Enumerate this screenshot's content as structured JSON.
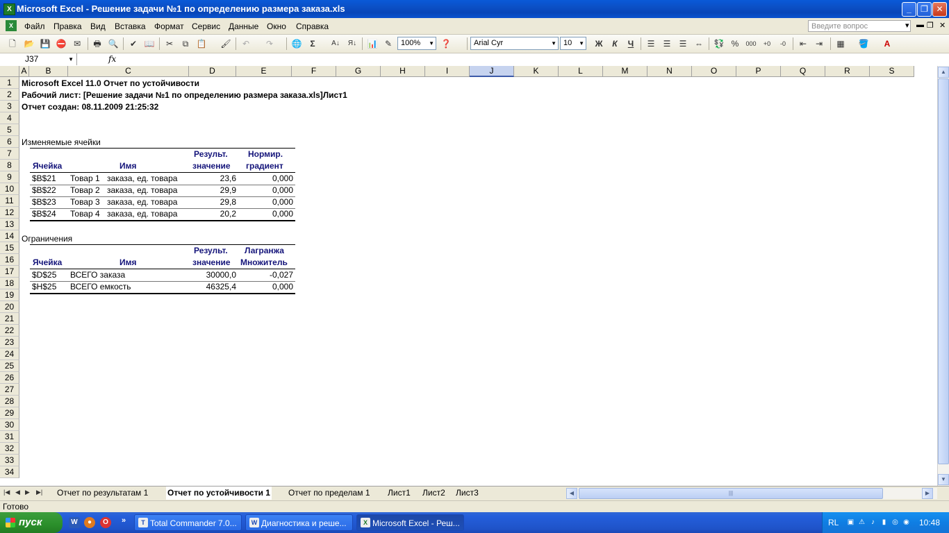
{
  "window": {
    "title": "Microsoft Excel - Решение задачи №1 по определению размера заказа.xls",
    "min": "_",
    "max": "❐",
    "close": "✕"
  },
  "menu": {
    "items": [
      "Файл",
      "Правка",
      "Вид",
      "Вставка",
      "Формат",
      "Сервис",
      "Данные",
      "Окно",
      "Справка"
    ],
    "help_placeholder": "Введите вопрос"
  },
  "toolbar": {
    "zoom": "100%",
    "font": "Arial Cyr",
    "size": "10",
    "bold": "Ж",
    "italic": "К",
    "underline": "Ч",
    "sigma": "Σ",
    "percent": "%",
    "thousands": "000"
  },
  "formula": {
    "cell_ref": "J37",
    "fx": "fx"
  },
  "columns": [
    "A",
    "B",
    "C",
    "D",
    "E",
    "F",
    "G",
    "H",
    "I",
    "J",
    "K",
    "L",
    "M",
    "N",
    "O",
    "P",
    "Q",
    "R",
    "S"
  ],
  "rows": [
    "1",
    "2",
    "3",
    "4",
    "5",
    "6",
    "7",
    "8",
    "9",
    "10",
    "11",
    "12",
    "13",
    "14",
    "15",
    "16",
    "17",
    "18",
    "19",
    "20",
    "21",
    "22",
    "23",
    "24",
    "25",
    "26",
    "27",
    "28",
    "29",
    "30",
    "31",
    "32",
    "33",
    "34"
  ],
  "report": {
    "line1": "Microsoft Excel 11.0 Отчет по устойчивости",
    "line2": "Рабочий лист: [Решение задачи №1 по определению размера заказа.xls]Лист1",
    "line3": "Отчет создан: 08.11.2009 21:25:32",
    "changing_title": "Изменяемые ячейки",
    "constraints_title": "Ограничения",
    "hdr_cell": "Ячейка",
    "hdr_name": "Имя",
    "hdr_result1": "Результ.",
    "hdr_result2": "значение",
    "hdr_grad1": "Нормир.",
    "hdr_grad2": "градиент",
    "hdr_lagr1": "Лагранжа",
    "hdr_lagr2": "Множитель",
    "changing": [
      {
        "cell": "$B$21",
        "name1": "Товар 1",
        "name2": "заказа, ед. товара",
        "value": "23,6",
        "grad": "0,000"
      },
      {
        "cell": "$B$22",
        "name1": "Товар 2",
        "name2": "заказа, ед. товара",
        "value": "29,9",
        "grad": "0,000"
      },
      {
        "cell": "$B$23",
        "name1": "Товар 3",
        "name2": "заказа, ед. товара",
        "value": "29,8",
        "grad": "0,000"
      },
      {
        "cell": "$B$24",
        "name1": "Товар 4",
        "name2": "заказа, ед. товара",
        "value": "20,2",
        "grad": "0,000"
      }
    ],
    "constraints": [
      {
        "cell": "$D$25",
        "name": "ВСЕГО заказа",
        "value": "30000,0",
        "lagr": "-0,027"
      },
      {
        "cell": "$H$25",
        "name": "ВСЕГО емкость",
        "value": "46325,4",
        "lagr": "0,000"
      }
    ]
  },
  "tabs": [
    "Отчет по результатам 1",
    "Отчет по устойчивости 1",
    "Отчет по пределам 1",
    "Лист1",
    "Лист2",
    "Лист3"
  ],
  "status": "Готово",
  "taskbar": {
    "start": "пуск",
    "tasks": [
      "Total Commander 7.0...",
      "Диагностика и реше...",
      "Microsoft Excel - Реш..."
    ],
    "lang": "RL",
    "clock": "10:48"
  }
}
